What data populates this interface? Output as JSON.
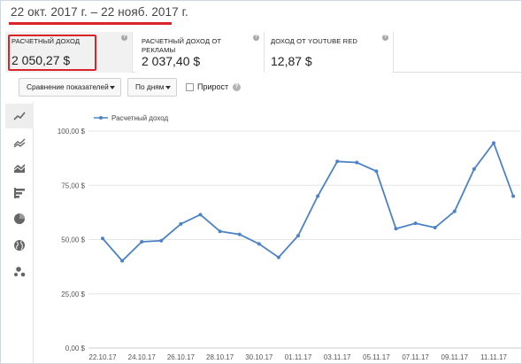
{
  "date_range": "22 окт. 2017 г. – 22 нояб. 2017 г.",
  "accent_color": "#d9252a",
  "metrics": [
    {
      "label": "РАСЧЕТНЫЙ ДОХОД",
      "value": "2 050,27 $",
      "selected": true
    },
    {
      "label": "РАСЧЕТНЫЙ ДОХОД ОТ РЕКЛАМЫ",
      "value": "2 037,40 $",
      "selected": false
    },
    {
      "label": "ДОХОД ОТ YOUTUBE RED",
      "value": "12,87 $",
      "selected": false
    }
  ],
  "help_icon_glyph": "?",
  "toolbar": {
    "compare_label": "Сравнение показателей",
    "period_label": "По дням",
    "growth_label": "Прирост",
    "growth_checked": false,
    "info_glyph": "?"
  },
  "sidebar_icons": [
    {
      "name": "line-chart-icon",
      "selected": true
    },
    {
      "name": "multi-line-chart-icon",
      "selected": false
    },
    {
      "name": "area-chart-icon",
      "selected": false
    },
    {
      "name": "bar-chart-icon",
      "selected": false
    },
    {
      "name": "pie-chart-icon",
      "selected": false
    },
    {
      "name": "globe-icon",
      "selected": false
    },
    {
      "name": "bubble-chart-icon",
      "selected": false
    }
  ],
  "chart_data": {
    "type": "line",
    "series": [
      {
        "name": "Расчетный доход",
        "color": "#4d82c4",
        "values": [
          50.5,
          40.2,
          49.0,
          49.5,
          57.2,
          61.5,
          53.8,
          52.4,
          48.0,
          41.8,
          51.8,
          70.0,
          86.0,
          85.5,
          81.5,
          55.0,
          57.5,
          55.5,
          63.0,
          82.5,
          94.5,
          70.0
        ]
      }
    ],
    "x_tick_labels": [
      "22.10.17",
      "24.10.17",
      "26.10.17",
      "28.10.17",
      "30.10.17",
      "01.11.17",
      "03.11.17",
      "05.11.17",
      "07.11.17",
      "09.11.17",
      "11.11.17"
    ],
    "y_tick_labels": [
      "0,00 $",
      "25,00 $",
      "50,00 $",
      "75,00 $",
      "100,00 $"
    ],
    "y_ticks": [
      0,
      25,
      50,
      75,
      100
    ],
    "ylim": [
      0,
      100
    ],
    "grid": true,
    "legend_position": "top-left"
  }
}
